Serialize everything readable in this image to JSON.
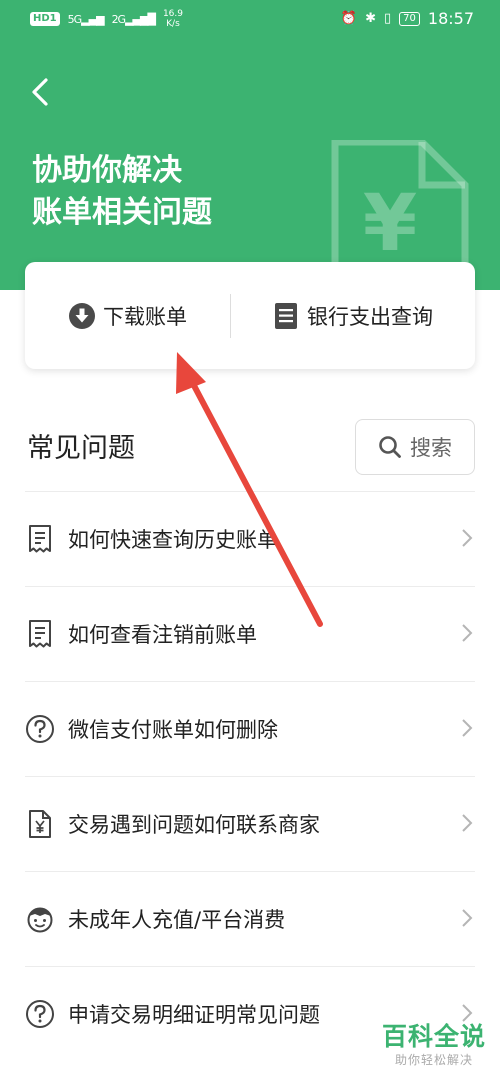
{
  "status_bar": {
    "hd_label": "HD",
    "sim1": "1",
    "net1": "5G",
    "net2": "2G",
    "speed_value": "16.9",
    "speed_unit": "K/s",
    "battery": "70",
    "time": "18:57"
  },
  "header": {
    "title_line1": "协助你解决",
    "title_line2": "账单相关问题",
    "bg_symbol": "¥",
    "color": "#3cb371"
  },
  "actions": {
    "download_label": "下载账单",
    "bank_label": "银行支出查询"
  },
  "faq": {
    "title": "常见问题",
    "search_label": "搜索",
    "items": [
      {
        "label": "如何快速查询历史账单",
        "icon": "receipt-icon"
      },
      {
        "label": "如何查看注销前账单",
        "icon": "receipt-icon"
      },
      {
        "label": "微信支付账单如何删除",
        "icon": "question-circle-icon"
      },
      {
        "label": "交易遇到问题如何联系商家",
        "icon": "yuan-document-icon"
      },
      {
        "label": "未成年人充值/平台消费",
        "icon": "child-face-icon"
      },
      {
        "label": "申请交易明细证明常见问题",
        "icon": "question-circle-icon"
      }
    ]
  },
  "watermark": {
    "brand": "百科全说",
    "slogan": "助你轻松解决"
  },
  "annotation": {
    "arrow_color": "#e8473c"
  }
}
